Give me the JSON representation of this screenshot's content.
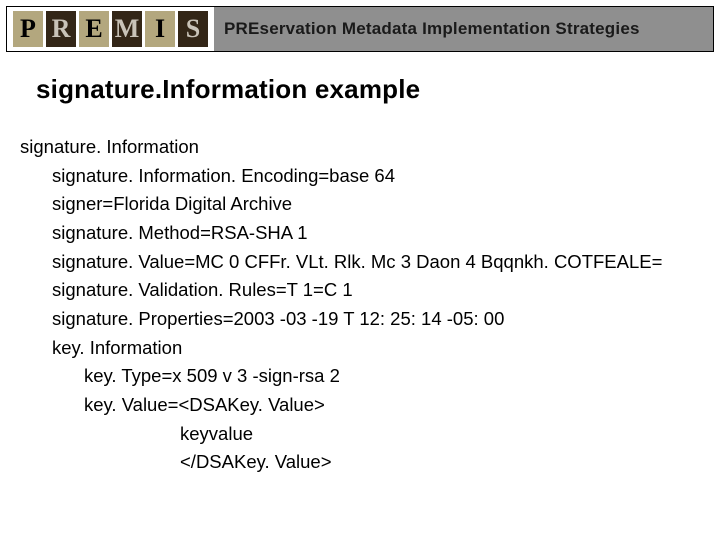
{
  "logo": {
    "letters": [
      "P",
      "R",
      "E",
      "M",
      "I",
      "S"
    ]
  },
  "strap": {
    "full": "PREservation Metadata Implementation Strategies"
  },
  "title": "signature.Information example",
  "lines": [
    {
      "cls": "",
      "text": "signature. Information"
    },
    {
      "cls": "ind1",
      "text": "signature. Information. Encoding=base 64"
    },
    {
      "cls": "ind1",
      "text": "signer=Florida Digital Archive"
    },
    {
      "cls": "ind1",
      "text": "signature. Method=RSA-SHA 1"
    },
    {
      "cls": "ind1",
      "text": "signature. Value=MC 0 CFFr. VLt. Rlk. Mc 3 Daon 4 Bqqnkh. COTFEALE="
    },
    {
      "cls": "ind1",
      "text": "signature. Validation. Rules=T 1=C 1"
    },
    {
      "cls": "ind1",
      "text": "signature. Properties=2003 -03 -19 T 12: 25: 14 -05: 00"
    },
    {
      "cls": "ind1",
      "text": "key. Information"
    },
    {
      "cls": "ind2",
      "text": "key. Type=x 509 v 3 -sign-rsa 2"
    },
    {
      "cls": "ind2",
      "text": "key. Value=<DSAKey. Value>"
    },
    {
      "cls": "ind3",
      "text": "keyvalue"
    },
    {
      "cls": "ind3",
      "text": "</DSAKey. Value>"
    }
  ]
}
